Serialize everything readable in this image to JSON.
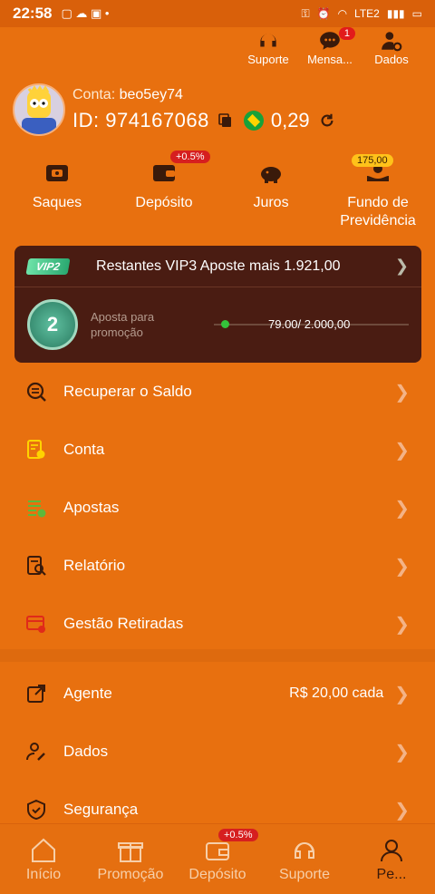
{
  "status_bar": {
    "time": "22:58",
    "network": "LTE2"
  },
  "top_actions": [
    {
      "label": "Suporte",
      "badge": ""
    },
    {
      "label": "Mensa...",
      "badge": "1"
    },
    {
      "label": "Dados",
      "badge": ""
    }
  ],
  "profile": {
    "account_label": "Conta:",
    "account": "beo5ey74",
    "id": "ID: 974167068",
    "balance": "0,29"
  },
  "quick_actions": [
    {
      "label": "Saques",
      "badge": ""
    },
    {
      "label": "Depósito",
      "badge": "+0.5%"
    },
    {
      "label": "Juros",
      "badge": ""
    },
    {
      "label": "Fundo de Previdência",
      "badge": "175,00"
    }
  ],
  "vip": {
    "tag": "VIP2",
    "text": "Restantes  VIP3  Aposte mais 1.921,00",
    "level": "2",
    "promo_label": "Aposta para promoção",
    "progress_text": "79.00/ 2.000,00",
    "progress_fraction": 0.0395
  },
  "menu_group1": [
    {
      "label": "Recuperar o Saldo"
    },
    {
      "label": "Conta"
    },
    {
      "label": "Apostas"
    },
    {
      "label": "Relatório"
    },
    {
      "label": "Gestão Retiradas"
    }
  ],
  "menu_group2": [
    {
      "label": "Agente",
      "value": "R$ 20,00 cada"
    },
    {
      "label": "Dados",
      "value": ""
    },
    {
      "label": "Segurança",
      "value": ""
    }
  ],
  "bottom_nav": [
    {
      "label": "Início",
      "badge": ""
    },
    {
      "label": "Promoção",
      "badge": ""
    },
    {
      "label": "Depósito",
      "badge": "+0.5%"
    },
    {
      "label": "Suporte",
      "badge": ""
    },
    {
      "label": "Pe...",
      "badge": ""
    }
  ],
  "colors": {
    "bg": "#e8700f",
    "vip_panel": "#4a1c12",
    "badge": "#d61f1f"
  }
}
